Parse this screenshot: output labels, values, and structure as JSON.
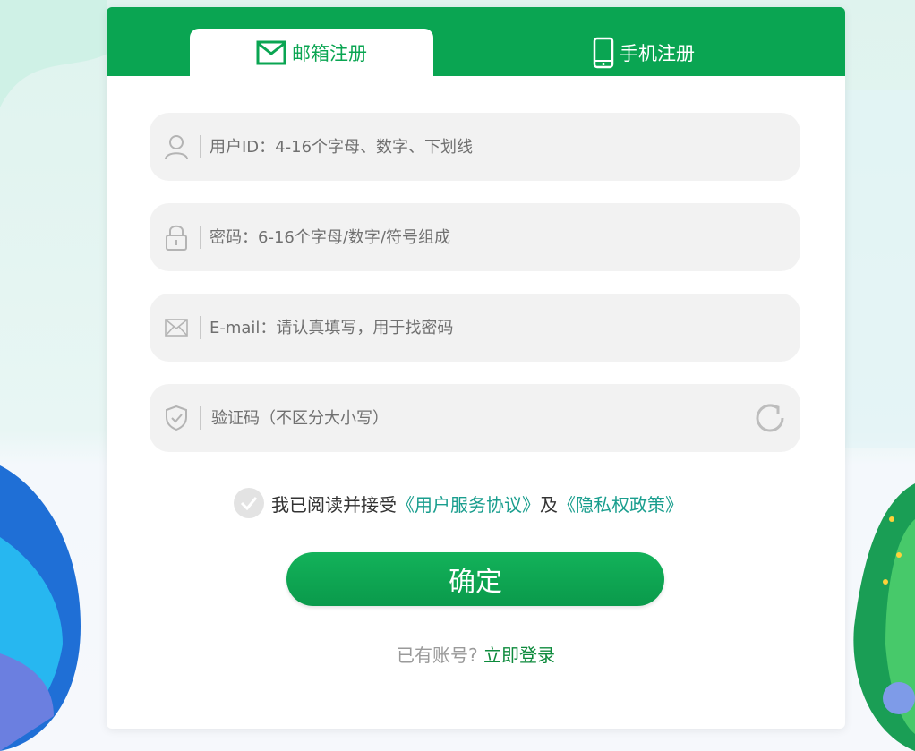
{
  "tabs": {
    "email_label": "邮箱注册",
    "phone_label": "手机注册"
  },
  "fields": {
    "user_id_placeholder": "用户ID：4-16个字母、数字、下划线",
    "password_placeholder": "密码：6-16个字母/数字/符号组成",
    "email_placeholder": "E-mail：请认真填写，用于找密码",
    "captcha_placeholder": "验证码（不区分大小写）"
  },
  "agreement": {
    "prefix": "我已阅读并接受",
    "service_link": "《用户服务协议》",
    "and_text": "及",
    "privacy_link": "《隐私权政策》"
  },
  "submit_label": "确定",
  "login": {
    "prompt": "已有账号?",
    "link": "立即登录"
  },
  "colors": {
    "brand_green": "#0aa552",
    "link_teal": "#1a9e8e",
    "field_bg": "#f2f2f2"
  },
  "icons": [
    "mail-icon",
    "phone-icon",
    "user-icon",
    "lock-icon",
    "envelope-icon",
    "shield-check-icon",
    "refresh-icon",
    "check-icon"
  ]
}
